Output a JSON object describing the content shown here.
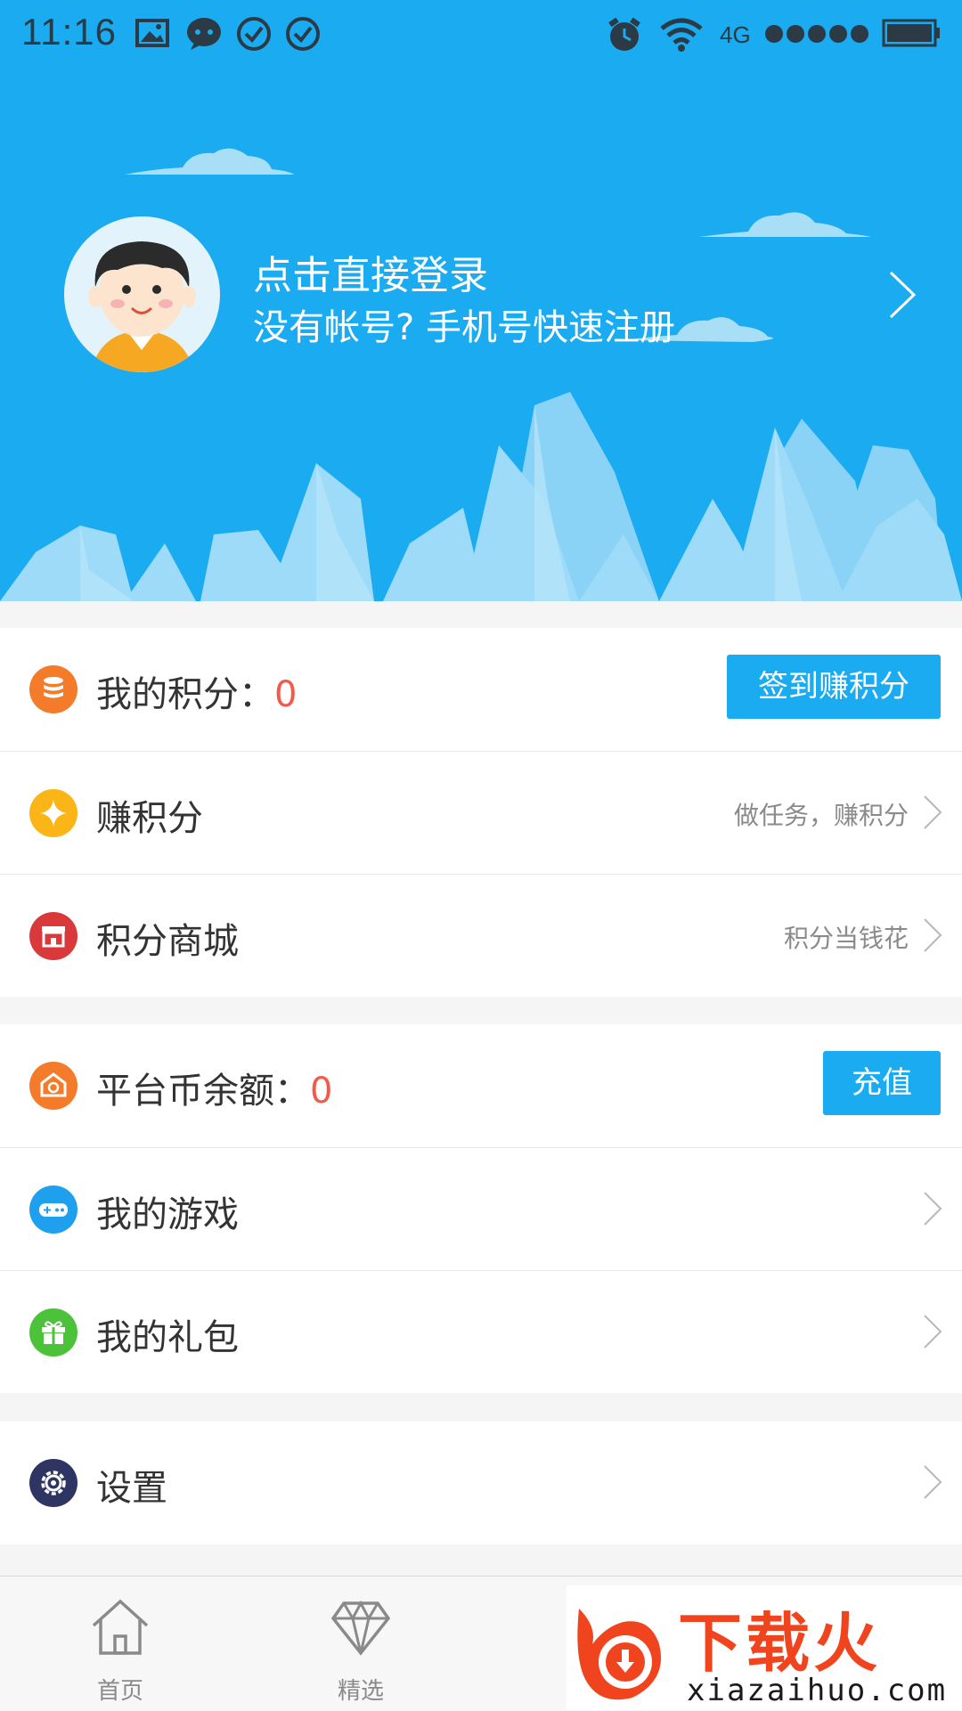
{
  "status_bar": {
    "time": "11:16",
    "network": "4G",
    "icons": [
      "image-icon",
      "chat-icon",
      "check-circle-icon",
      "check-circle-icon",
      "alarm-icon",
      "wifi-icon",
      "signal-icon",
      "battery-icon"
    ]
  },
  "profile": {
    "title": "点击直接登录",
    "subtitle": "没有帐号? 手机号快速注册"
  },
  "points_section": {
    "my_points_label": "我的积分：",
    "my_points_value": "0",
    "checkin_button": "签到赚积分",
    "earn_label": "赚积分",
    "earn_hint": "做任务，赚积分",
    "mall_label": "积分商城",
    "mall_hint": "积分当钱花"
  },
  "wallet_section": {
    "balance_label": "平台币余额：",
    "balance_value": "0",
    "recharge_button": "充值",
    "games_label": "我的游戏",
    "gifts_label": "我的礼包"
  },
  "settings_section": {
    "settings_label": "设置"
  },
  "tabbar": {
    "tabs": [
      {
        "label": "首页",
        "icon": "home-icon"
      },
      {
        "label": "精选",
        "icon": "diamond-icon"
      }
    ]
  },
  "watermark": {
    "text": "下载火",
    "url": "xiazaihuo.com"
  },
  "colors": {
    "header_blue": "#1aabf0",
    "accent_red": "#f15a4a",
    "button_blue": "#1aabf0"
  }
}
